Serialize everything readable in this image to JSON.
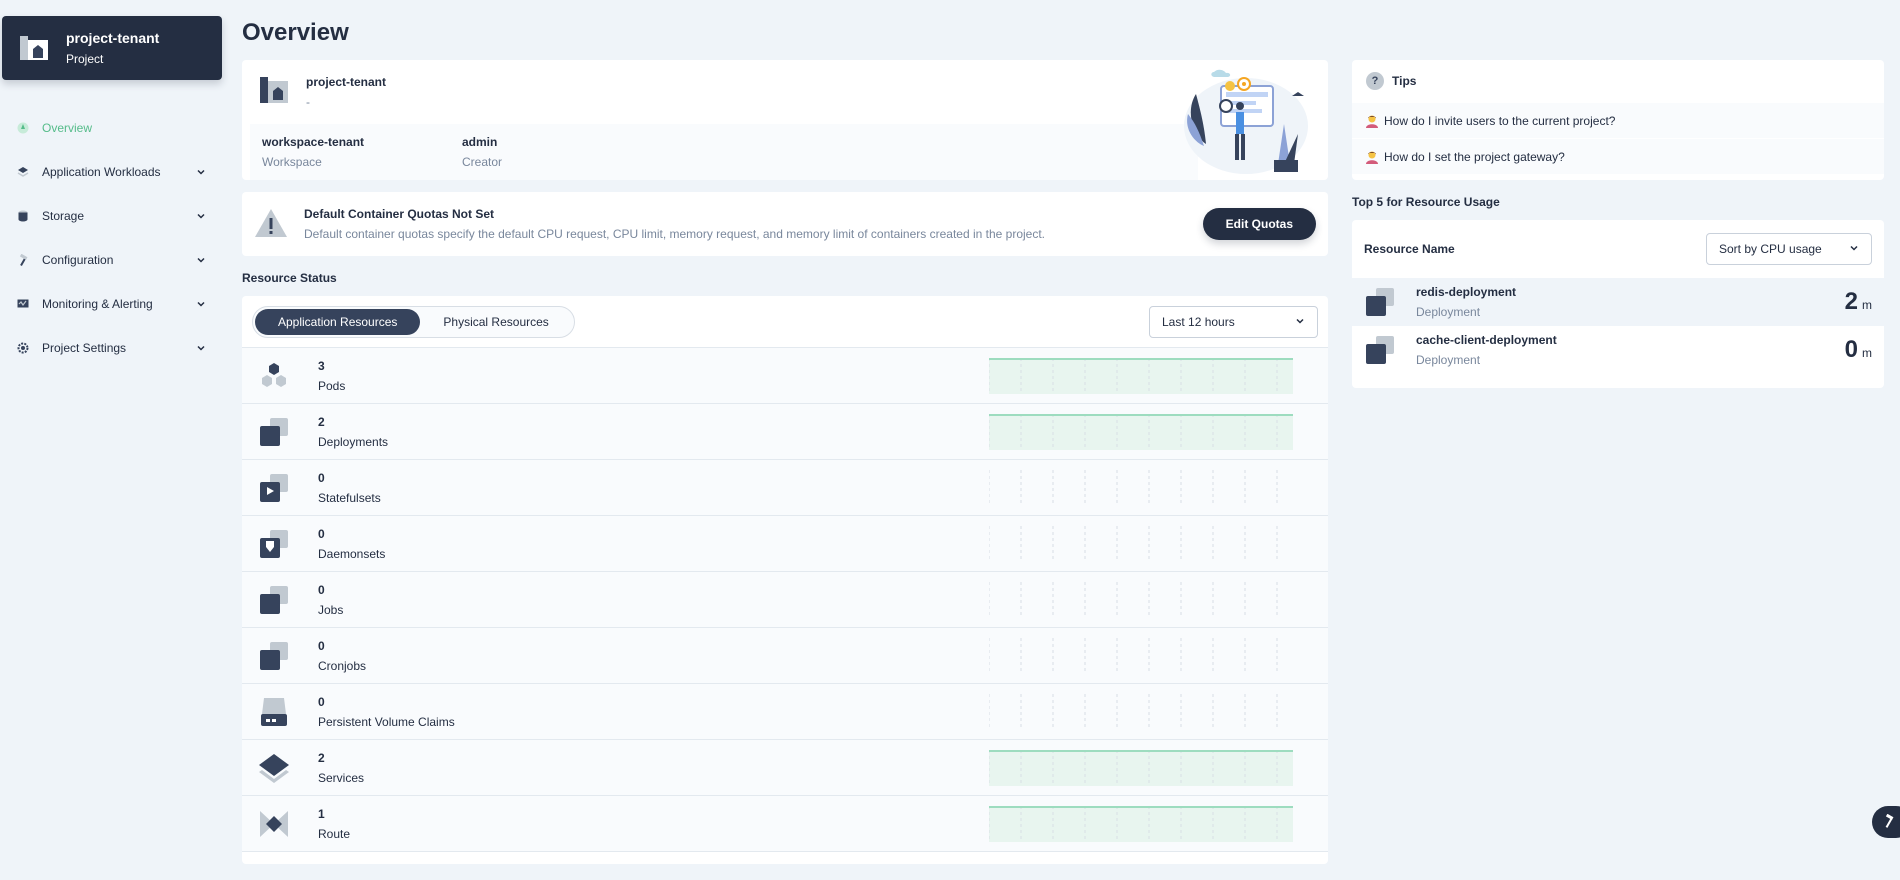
{
  "project": {
    "name": "project-tenant",
    "type": "Project"
  },
  "nav": [
    {
      "label": "Overview",
      "icon": "overview-icon",
      "active": true,
      "chevron": false
    },
    {
      "label": "Application Workloads",
      "icon": "layers-icon",
      "chevron": true
    },
    {
      "label": "Storage",
      "icon": "database-icon",
      "chevron": true
    },
    {
      "label": "Configuration",
      "icon": "hammer-icon",
      "chevron": true
    },
    {
      "label": "Monitoring & Alerting",
      "icon": "monitor-icon",
      "chevron": true
    },
    {
      "label": "Project Settings",
      "icon": "gear-icon",
      "chevron": true
    }
  ],
  "page": {
    "title": "Overview"
  },
  "info": {
    "name": "project-tenant",
    "description": "-",
    "workspace_value": "workspace-tenant",
    "workspace_label": "Workspace",
    "creator_value": "admin",
    "creator_label": "Creator"
  },
  "quota": {
    "title": "Default Container Quotas Not Set",
    "description": "Default container quotas specify the default CPU request, CPU limit, memory request, and memory limit of containers created in the project.",
    "button": "Edit Quotas"
  },
  "resource_status": {
    "title": "Resource Status",
    "tabs": [
      "Application Resources",
      "Physical Resources"
    ],
    "time_range": "Last 12 hours",
    "rows": [
      {
        "count": "3",
        "name": "Pods",
        "icon": "pods-icon",
        "has_data": true
      },
      {
        "count": "2",
        "name": "Deployments",
        "icon": "deployment-icon",
        "has_data": true
      },
      {
        "count": "0",
        "name": "Statefulsets",
        "icon": "statefulset-icon",
        "has_data": false
      },
      {
        "count": "0",
        "name": "Daemonsets",
        "icon": "daemonset-icon",
        "has_data": false
      },
      {
        "count": "0",
        "name": "Jobs",
        "icon": "job-icon",
        "has_data": false
      },
      {
        "count": "0",
        "name": "Cronjobs",
        "icon": "cronjob-icon",
        "has_data": false
      },
      {
        "count": "0",
        "name": "Persistent Volume Claims",
        "icon": "pvc-icon",
        "has_data": false
      },
      {
        "count": "2",
        "name": "Services",
        "icon": "service-icon",
        "has_data": true
      },
      {
        "count": "1",
        "name": "Route",
        "icon": "route-icon",
        "has_data": true
      }
    ]
  },
  "tips": {
    "title": "Tips",
    "items": [
      "How do I invite users to the current project?",
      "How do I set the project gateway?"
    ]
  },
  "top5": {
    "title": "Top 5 for Resource Usage",
    "column": "Resource Name",
    "sort": "Sort by CPU usage",
    "rows": [
      {
        "name": "redis-deployment",
        "type": "Deployment",
        "value": "2",
        "unit": "m"
      },
      {
        "name": "cache-client-deployment",
        "type": "Deployment",
        "value": "0",
        "unit": "m"
      }
    ]
  },
  "colors": {
    "dark": "#242e42",
    "accent": "#55bc8a",
    "muted": "#79879c",
    "background": "#eff4f9"
  }
}
